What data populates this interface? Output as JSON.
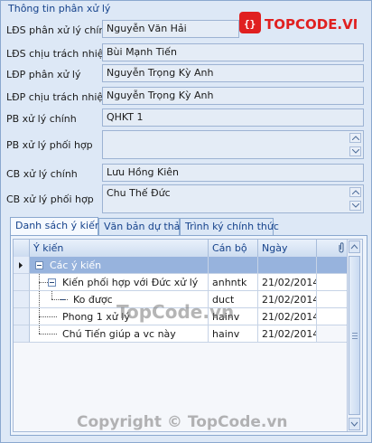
{
  "group_title": "Thông tin phân xử lý",
  "form": [
    {
      "label": "LĐS phân xử lý chính",
      "value": "Nguyễn Văn Hải"
    },
    {
      "label": "LĐS chịu trách nhiệm",
      "value": "Bùi Mạnh Tiến"
    },
    {
      "label": "LĐP phân xử lý",
      "value": "Nguyễn Trọng Kỳ Anh"
    },
    {
      "label": "LĐP chịu trách nhiệm",
      "value": "Nguyễn Trọng Kỳ Anh"
    },
    {
      "label": "PB xử lý chính",
      "value": "QHKT 1"
    },
    {
      "label": "PB xử lý phối hợp",
      "value": ""
    },
    {
      "label": "CB xử lý chính",
      "value": "Lưu Hồng Kiên"
    },
    {
      "label": "CB xử lý phối hợp",
      "value": "Chu Thế Đức"
    }
  ],
  "logo": {
    "text": "TOPCODE.VN"
  },
  "tabs": [
    "Danh sách ý kiến",
    "Văn bản dự thảo",
    "Trình ký chính thức"
  ],
  "grid": {
    "headers": [
      "Ý kiến",
      "Cán bộ",
      "Ngày"
    ],
    "rows": [
      {
        "y_kien": "Các ý kiến",
        "can_bo": "",
        "ngay": ""
      },
      {
        "y_kien": "Kiến phối hợp với Đức xử lý",
        "can_bo": "anhntk",
        "ngay": "21/02/2014"
      },
      {
        "y_kien": "Ko được",
        "can_bo": "duct",
        "ngay": "21/02/2014"
      },
      {
        "y_kien": "Phong 1 xử lý",
        "can_bo": "hainv",
        "ngay": "21/02/2014"
      },
      {
        "y_kien": "Chú Tiến giúp a vc này",
        "can_bo": "hainv",
        "ngay": "21/02/2014"
      }
    ]
  },
  "watermarks": [
    "TopCode.vn",
    "Copyright © TopCode.vn"
  ],
  "colors": {
    "selection": "#97b3dd",
    "title": "#15428b",
    "logo_red": "#e02020"
  }
}
